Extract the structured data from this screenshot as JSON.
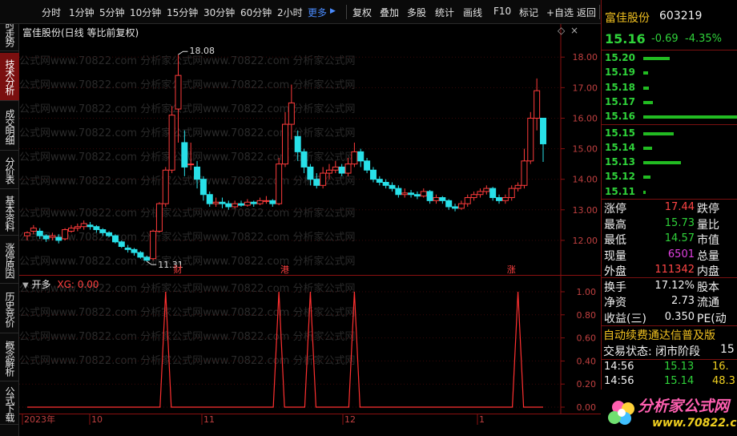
{
  "toolbar": {
    "items": [
      "分时",
      "1分钟",
      "5分钟",
      "10分钟",
      "15分钟",
      "30分钟",
      "60分钟",
      "2小时",
      "更多",
      "复权",
      "叠加",
      "多股",
      "统计",
      "画线",
      "F10",
      "标记",
      "+自选",
      "返回"
    ]
  },
  "left_tabs": [
    "分时走势",
    "技术分析",
    "成交明细",
    "分价表",
    "基本资料",
    "涨停原因",
    "历史竞价",
    "概念解析",
    "公式下载"
  ],
  "main_chart": {
    "title": "富佳股份(日线 等比前复权)",
    "high_label": "18.08",
    "low_label": "11.31",
    "markers": [
      "财",
      "港",
      "涨"
    ],
    "watermark": "公式网www.70822.com 分析家公式网www.70822.com 分析家公式网"
  },
  "indicator": {
    "name": "开多",
    "value_label": "XG: 0.00"
  },
  "date_axis": [
    "2023年",
    "10",
    "11",
    "12",
    "1"
  ],
  "quote": {
    "name": "富佳股份",
    "code": "603219",
    "price": "15.16",
    "change": "-0.69",
    "change_pct": "-4.35%",
    "orderbook": [
      {
        "price": "15.20",
        "volume_fraction": 0.28
      },
      {
        "price": "15.19",
        "volume_fraction": 0.05
      },
      {
        "price": "15.18",
        "volume_fraction": 0.06
      },
      {
        "price": "15.17",
        "volume_fraction": 0.1
      },
      {
        "price": "15.16",
        "volume_fraction": 1.0
      },
      {
        "price": "15.15",
        "volume_fraction": 0.32
      },
      {
        "price": "15.14",
        "volume_fraction": 0.09
      },
      {
        "price": "15.13",
        "volume_fraction": 0.4
      },
      {
        "price": "15.12",
        "volume_fraction": 0.08
      },
      {
        "price": "15.11",
        "volume_fraction": 0.02
      }
    ],
    "stats": [
      {
        "label": "涨停",
        "value": "17.44",
        "value_color": "#ff4545",
        "label2": "跌停"
      },
      {
        "label": "最高",
        "value": "15.73",
        "value_color": "#2fd23a",
        "label2": "量比"
      },
      {
        "label": "最低",
        "value": "14.57",
        "value_color": "#2fd23a",
        "label2": "市值"
      },
      {
        "label": "现量",
        "value": "6501",
        "value_color": "#e040e0",
        "label2": "总量"
      },
      {
        "label": "外盘",
        "value": "111342",
        "value_color": "#ff4545",
        "label2": "内盘"
      },
      {
        "label": "换手",
        "value": "17.12%",
        "value_color": "#f0f0f0",
        "label2": "股本"
      },
      {
        "label": "净资",
        "value": "2.73",
        "value_color": "#f0f0f0",
        "label2": "流通"
      },
      {
        "label": "收益(三)",
        "value": "0.350",
        "value_color": "#f0f0f0",
        "label2": "PE(动"
      }
    ],
    "promo": "自动续费通达信普及版",
    "trade_status_label": "交易状态: 闭市阶段",
    "trade_status_num": "15",
    "ticks": [
      {
        "time": "14:56",
        "price": "15.13",
        "vol": "16."
      },
      {
        "time": "14:56",
        "price": "15.14",
        "vol": "48.3"
      }
    ]
  },
  "logo": {
    "text": "分析家公式网",
    "url": "www.70822.com"
  },
  "colors": {
    "up": "#ff3b3b",
    "down": "#28e0e8",
    "price_green": "#2fd23a",
    "panel_border": "#7a1010",
    "accent_yellow": "#f0c020"
  }
}
